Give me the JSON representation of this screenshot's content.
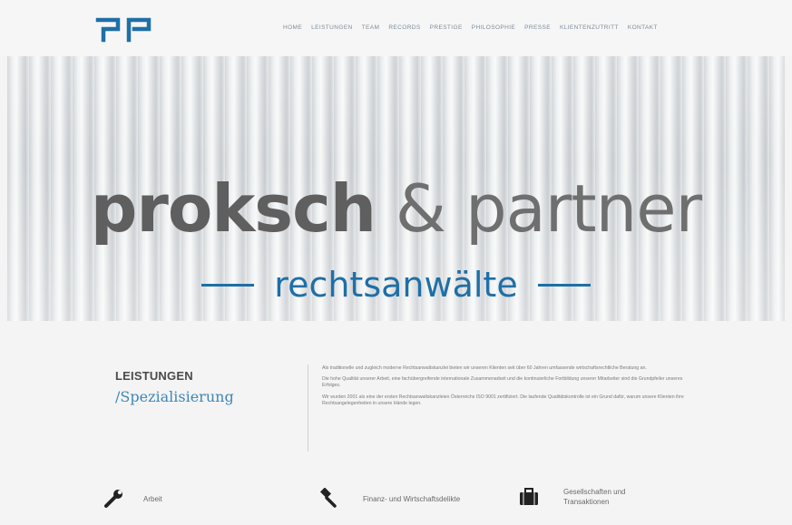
{
  "header": {
    "logo_icon": "gp-logo",
    "nav": [
      "HOME",
      "LEISTUNGEN",
      "TEAM",
      "RECORDS",
      "PRESTIGE",
      "PHILOSOPHIE",
      "PRESSE",
      "KLIENTENZUTRITT",
      "KONTAKT"
    ]
  },
  "hero": {
    "title_strong": "proksch",
    "title_rest": " & partner",
    "subtitle": "rechtsanwälte",
    "accent": "#1f6fa6"
  },
  "section": {
    "title": "LEISTUNGEN",
    "subtitle": "/Spezialisierung",
    "paragraphs": [
      "Als traditionelle und zugleich moderne Rechtsanwaltskanzlei bieten wir unseren Klienten seit über 60 Jahren umfassende wirtschaftsrechtliche Beratung an.",
      "Die hohe Qualität unserer Arbeit, eine fachübergreifende internationale Zusammenarbeit und die kontinuierliche Fortbildung unserer Mitarbeiter sind die Grundpfeiler unseres Erfolges.",
      "Wir wurden 2001 als eine der ersten Rechtsanwaltskanzleien Österreichs ISO 9001 zertifiziert. Die laufende Qualitätskontrolle ist ein Grund dafür, warum unsere Klienten ihre Rechtsangelegenheiten in unsere Hände legen."
    ]
  },
  "services": [
    {
      "label": "Arbeit",
      "icon": "wrench-icon"
    },
    {
      "label": "Finanz- und Wirtschaftsdelikte",
      "icon": "gavel-icon"
    },
    {
      "label": "Gesellschaften und Transaktionen",
      "icon": "briefcase-icon"
    }
  ]
}
